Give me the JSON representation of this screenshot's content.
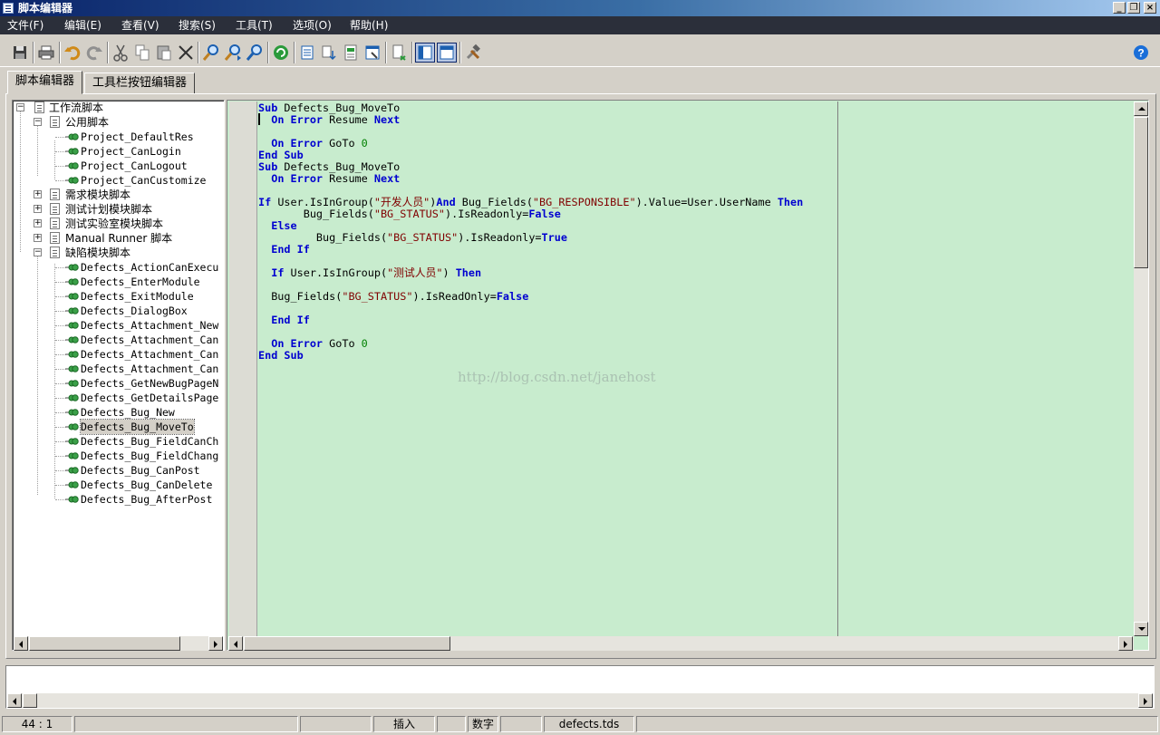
{
  "window": {
    "title": "脚本编辑器"
  },
  "menu": [
    "文件(F)",
    "编辑(E)",
    "查看(V)",
    "搜索(S)",
    "工具(T)",
    "选项(O)",
    "帮助(H)"
  ],
  "toolbar_icons": [
    "save-icon",
    "print-icon",
    "undo-icon",
    "redo-icon",
    "cut-icon",
    "copy-icon",
    "paste-icon",
    "delete-icon",
    "find-icon",
    "find-next-icon",
    "replace-icon",
    "refresh-icon",
    "list-view-icon",
    "move-down-icon",
    "check-syntax-icon",
    "script-props-icon",
    "insert-icon",
    "layout-1-icon",
    "layout-2-icon",
    "tools-icon"
  ],
  "tabs": [
    "脚本编辑器",
    "工具栏按钮编辑器"
  ],
  "tree": {
    "root": "工作流脚本",
    "common": {
      "label": "公用脚本",
      "items": [
        "Project_DefaultRes",
        "Project_CanLogin",
        "Project_CanLogout",
        "Project_CanCustomize"
      ]
    },
    "folders": [
      "需求模块脚本",
      "测试计划模块脚本",
      "测试实验室模块脚本",
      "Manual Runner 脚本"
    ],
    "defects": {
      "label": "缺陷模块脚本",
      "items": [
        "Defects_ActionCanExecu",
        "Defects_EnterModule",
        "Defects_ExitModule",
        "Defects_DialogBox",
        "Defects_Attachment_New",
        "Defects_Attachment_Can",
        "Defects_Attachment_Can",
        "Defects_Attachment_Can",
        "Defects_GetNewBugPageN",
        "Defects_GetDetailsPage",
        "Defects_Bug_New",
        "Defects_Bug_MoveTo",
        "Defects_Bug_FieldCanCh",
        "Defects_Bug_FieldChang",
        "Defects_Bug_CanPost",
        "Defects_Bug_CanDelete",
        "Defects_Bug_AfterPost"
      ],
      "selected": "Defects_Bug_MoveTo"
    }
  },
  "code": [
    [
      [
        "k",
        "Sub"
      ],
      [
        "p",
        " Defects_Bug_MoveTo"
      ]
    ],
    [
      [
        "p",
        "  "
      ],
      [
        "k",
        "On Error"
      ],
      [
        "p",
        " Resume "
      ],
      [
        "k",
        "Next"
      ]
    ],
    [],
    [
      [
        "p",
        "  "
      ],
      [
        "k",
        "On Error"
      ],
      [
        "p",
        " GoTo "
      ],
      [
        "n",
        "0"
      ]
    ],
    [
      [
        "k",
        "End Sub"
      ]
    ],
    [
      [
        "k",
        "Sub"
      ],
      [
        "p",
        " Defects_Bug_MoveTo"
      ]
    ],
    [
      [
        "p",
        "  "
      ],
      [
        "k",
        "On Error"
      ],
      [
        "p",
        " Resume "
      ],
      [
        "k",
        "Next"
      ]
    ],
    [],
    [
      [
        "k",
        "If"
      ],
      [
        "p",
        " User.IsInGroup("
      ],
      [
        "s",
        "\"开发人员\""
      ],
      [
        "p",
        ")"
      ],
      [
        "k",
        "And"
      ],
      [
        "p",
        " Bug_Fields("
      ],
      [
        "s",
        "\"BG_RESPONSIBLE\""
      ],
      [
        "p",
        ").Value=User.UserName "
      ],
      [
        "k",
        "Then"
      ]
    ],
    [
      [
        "p",
        "       Bug_Fields("
      ],
      [
        "s",
        "\"BG_STATUS\""
      ],
      [
        "p",
        ").IsReadonly="
      ],
      [
        "k",
        "False"
      ]
    ],
    [
      [
        "p",
        "  "
      ],
      [
        "k",
        "Else"
      ]
    ],
    [
      [
        "p",
        "         Bug_Fields("
      ],
      [
        "s",
        "\"BG_STATUS\""
      ],
      [
        "p",
        ").IsReadonly="
      ],
      [
        "k",
        "True"
      ]
    ],
    [
      [
        "p",
        "  "
      ],
      [
        "k",
        "End If"
      ]
    ],
    [],
    [
      [
        "p",
        "  "
      ],
      [
        "k",
        "If"
      ],
      [
        "p",
        " User.IsInGroup("
      ],
      [
        "s",
        "\"测试人员\""
      ],
      [
        "p",
        ") "
      ],
      [
        "k",
        "Then"
      ]
    ],
    [],
    [
      [
        "p",
        "  Bug_Fields("
      ],
      [
        "s",
        "\"BG_STATUS\""
      ],
      [
        "p",
        ").IsReadOnly="
      ],
      [
        "k",
        "False"
      ]
    ],
    [],
    [
      [
        "p",
        "  "
      ],
      [
        "k",
        "End If"
      ]
    ],
    [],
    [
      [
        "p",
        "  "
      ],
      [
        "k",
        "On Error"
      ],
      [
        "p",
        " GoTo "
      ],
      [
        "n",
        "0"
      ]
    ],
    [
      [
        "k",
        "End Sub"
      ]
    ]
  ],
  "watermark": "http://blog.csdn.net/janehost",
  "status": {
    "position": "44 : 1",
    "mode": "插入",
    "numlock": "数字",
    "file": "defects.tds"
  },
  "colors": {
    "editor_bg": "#c8ecce",
    "keyword": "#0000d0",
    "string": "#800000",
    "number": "#008000"
  }
}
